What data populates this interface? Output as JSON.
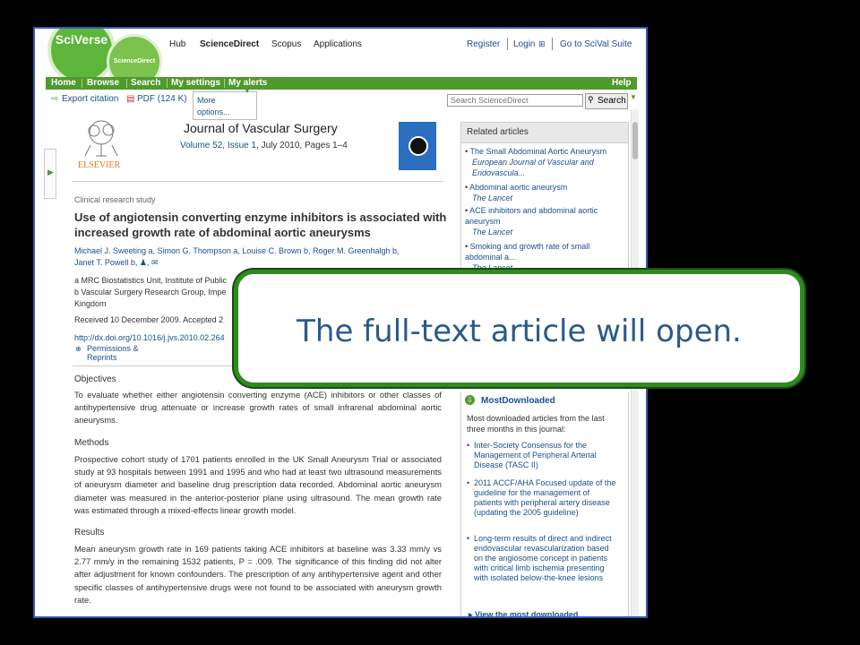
{
  "header": {
    "logo_text": "SciVerse",
    "logo_sub": "ScienceDirect",
    "top_links": [
      "Hub",
      "ScienceDirect",
      "Scopus",
      "Applications"
    ],
    "register": "Register",
    "login": "Login",
    "scival": "Go to SciVal Suite"
  },
  "nav": {
    "items": [
      "Home",
      "Browse",
      "Search",
      "My settings",
      "My alerts"
    ],
    "help": "Help"
  },
  "toolbar": {
    "export": "Export citation",
    "pdf": "PDF (124 K)",
    "more_line1": "More",
    "more_line2": "options...",
    "search_placeholder": "Search ScienceDirect",
    "search_button": "Search"
  },
  "journal": {
    "publisher": "ELSEVIER",
    "title": "Journal of Vascular Surgery",
    "volume": "Volume 52, Issue 1",
    "date_pages": ", July 2010, Pages 1–4"
  },
  "article": {
    "type": "Clinical research study",
    "title": "Use of angiotensin converting enzyme inhibitors is associated with increased growth rate of abdominal aortic aneurysms",
    "authors_line1": "Michael J. Sweeting a, Simon G. Thompson a, Louise C. Brown b, Roger M. Greenhalgh b,",
    "authors_line2": "Janet T. Powell b, ♟, ✉",
    "affil_a": "a MRC Biostatistics Unit, Institute of Public",
    "affil_b": "b Vascular Surgery Research Group, Impe",
    "affil_c": "Kingdom",
    "received": "Received 10 December 2009. Accepted 2",
    "doi": "http://dx.doi.org/10.1016/j.jvs.2010.02.264",
    "permissions_line1": "Permissions &",
    "permissions_line2": "Reprints",
    "objectives_h": "Objectives",
    "objectives": "To evaluate whether either angiotensin converting enzyme (ACE) inhibitors or other classes of antihypertensive drug attenuate or increase growth rates of small infrarenal abdominal aortic aneurysms.",
    "methods_h": "Methods",
    "methods": "Prospective cohort study of 1701 patients enrolled in the UK Small Aneurysm Trial or associated study at 93 hospitals between 1991 and 1995 and who had at least two ultrasound measurements of aneurysm diameter and baseline drug prescription data recorded. Abdominal aortic aneurysm diameter was measured in the anterior-posterior plane using ultrasound. The mean growth rate was estimated through a mixed-effects linear growth model.",
    "results_h": "Results",
    "results": "Mean aneurysm growth rate in 169 patients taking ACE inhibitors at baseline was 3.33 mm/y vs 2.77 mm/y in the remaining 1532 patients, P = .009. The significance of this finding did not alter after adjustment for known confounders. The prescription of any antihypertensive agent and other specific classes of antihypertensive drugs were not found to be associated with aneurysm growth rate."
  },
  "related": {
    "heading": "Related articles",
    "items": [
      {
        "title": "The Small Abdominal Aortic Aneurysm",
        "journal": "European Journal of Vascular and Endovascula..."
      },
      {
        "title": "Abdominal aortic aneurysm",
        "journal": "The Lancet"
      },
      {
        "title": "ACE inhibitors and abdominal aortic aneurysm",
        "journal": "The Lancet"
      },
      {
        "title": "Smoking and growth rate of small abdominal a...",
        "journal": "The Lancet"
      }
    ]
  },
  "most_downloaded": {
    "title": "MostDownloaded",
    "desc": "Most downloaded articles from the last three months in this journal:",
    "items": [
      "Inter-Society Consensus for the Management of Peripheral Arterial Disease (TASC II)",
      "2011 ACCF/AHA Focused update of the guideline for the management of patients with peripheral artery disease (updating the 2005 guideline)",
      "Long-term results of direct and indirect endovascular revascularization based on the angiosome concept in patients with critical limb ischemia presenting with isolated below-the-knee lesions"
    ],
    "view_all": "View the most downloaded"
  },
  "callout": {
    "text": "The full-text article will open."
  }
}
